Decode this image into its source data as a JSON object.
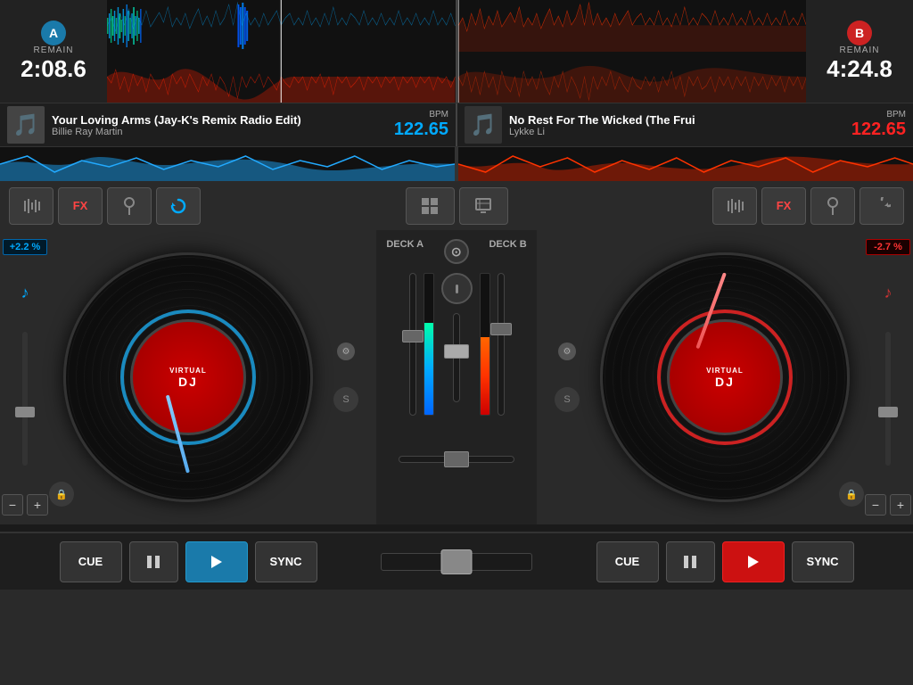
{
  "app": {
    "title": "VirtualDJ"
  },
  "deck_a": {
    "label": "A",
    "remain": "REMAIN",
    "time": "2:08.6",
    "song_title": "Your Loving Arms (Jay-K's Remix Radio Edit)",
    "artist": "Billie Ray Martin",
    "bpm_label": "BPM",
    "bpm": "122.65",
    "pitch": "+2.2 %",
    "logo": "VIRTUALDJ"
  },
  "deck_b": {
    "label": "B",
    "remain": "REMAIN",
    "time": "4:24.8",
    "song_title": "No Rest For The Wicked (The Frui",
    "artist": "Lykke Li",
    "bpm_label": "BPM",
    "bpm": "122.65",
    "pitch": "-2.7 %",
    "logo": "VIRTUALDJ"
  },
  "controls": {
    "eq_icon": "⊟",
    "fx_label": "FX",
    "pin_icon": "📍",
    "reload_icon": "↺",
    "grid_icon": "⊞",
    "folder_icon": "🗁"
  },
  "transport": {
    "cue_a": "CUE",
    "pause_a": "⏸",
    "play_a": "▶",
    "sync_a": "SYNC",
    "cue_b": "CUE",
    "pause_b": "⏸",
    "play_b": "▶",
    "sync_b": "SYNC"
  }
}
